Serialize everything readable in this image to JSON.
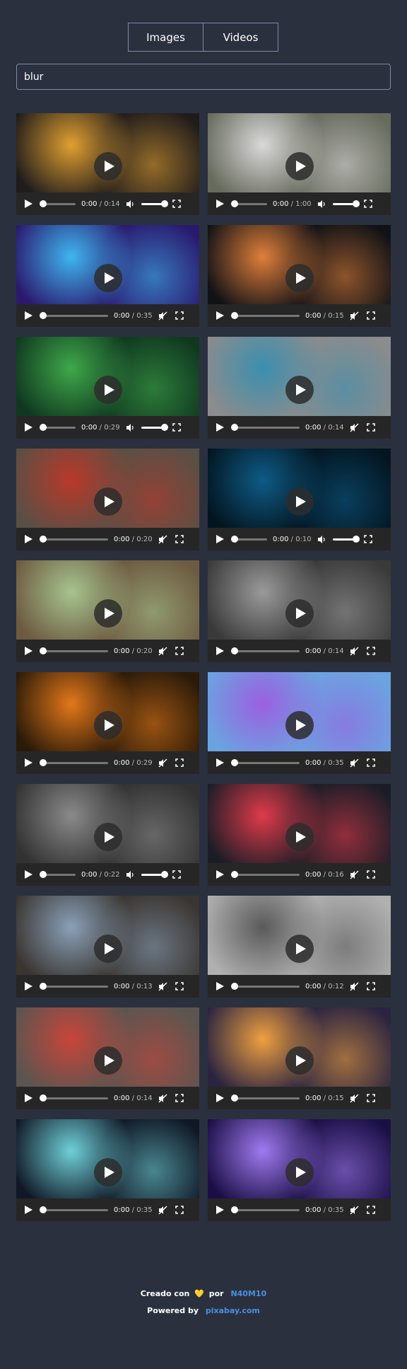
{
  "tabs": [
    {
      "label": "Images"
    },
    {
      "label": "Videos"
    }
  ],
  "search": {
    "value": "blur"
  },
  "videos": [
    {
      "current": "0:00",
      "duration": "0:14",
      "muted": false,
      "bg": "#201c1c",
      "accent": "#e0a030"
    },
    {
      "current": "0:00",
      "duration": "1:00",
      "muted": false,
      "bg": "#676a5d",
      "accent": "#d9d9d9"
    },
    {
      "current": "0:00",
      "duration": "0:35",
      "muted": true,
      "bg": "#2a1a6e",
      "accent": "#3fb6f0"
    },
    {
      "current": "0:00",
      "duration": "0:15",
      "muted": true,
      "bg": "#111216",
      "accent": "#e07f3a"
    },
    {
      "current": "0:00",
      "duration": "0:29",
      "muted": false,
      "bg": "#103820",
      "accent": "#3fa84a"
    },
    {
      "current": "0:00",
      "duration": "0:14",
      "muted": true,
      "bg": "#8c8c8c",
      "accent": "#3a8fb0"
    },
    {
      "current": "0:00",
      "duration": "0:20",
      "muted": true,
      "bg": "#5a4f45",
      "accent": "#b8392a"
    },
    {
      "current": "0:00",
      "duration": "0:10",
      "muted": false,
      "bg": "#031520",
      "accent": "#0e5b86"
    },
    {
      "current": "0:00",
      "duration": "0:20",
      "muted": true,
      "bg": "#6d5a40",
      "accent": "#a7c48f"
    },
    {
      "current": "0:00",
      "duration": "0:14",
      "muted": true,
      "bg": "#3a3a3a",
      "accent": "#9a9a9a"
    },
    {
      "current": "0:00",
      "duration": "0:29",
      "muted": true,
      "bg": "#2a1a08",
      "accent": "#e3781a"
    },
    {
      "current": "0:00",
      "duration": "0:35",
      "muted": true,
      "bg": "#6aa4e0",
      "accent": "#9b5fe0"
    },
    {
      "current": "0:00",
      "duration": "0:22",
      "muted": false,
      "bg": "#323232",
      "accent": "#8a8a8a"
    },
    {
      "current": "0:00",
      "duration": "0:16",
      "muted": true,
      "bg": "#1a1d26",
      "accent": "#e03a4a"
    },
    {
      "current": "0:00",
      "duration": "0:13",
      "muted": true,
      "bg": "#3a3530",
      "accent": "#8aa0b8"
    },
    {
      "current": "0:00",
      "duration": "0:12",
      "muted": true,
      "bg": "#b0b0b0",
      "accent": "#5a5a5a"
    },
    {
      "current": "0:00",
      "duration": "0:14",
      "muted": true,
      "bg": "#5a5550",
      "accent": "#c8453a"
    },
    {
      "current": "0:00",
      "duration": "0:15",
      "muted": true,
      "bg": "#2a2440",
      "accent": "#f0a040"
    },
    {
      "current": "0:00",
      "duration": "0:35",
      "muted": true,
      "bg": "#101825",
      "accent": "#6fd0d8"
    },
    {
      "current": "0:00",
      "duration": "0:35",
      "muted": true,
      "bg": "#1a0f45",
      "accent": "#a07af0"
    }
  ],
  "footer": {
    "created_text": "Creado con",
    "heart": "💛",
    "by_text": "por",
    "author": "N40M10",
    "powered_text": "Powered by",
    "powered_link": "pixabay.com"
  },
  "colors": {
    "background": "#2b303e",
    "border": "#7f8aa8",
    "link": "#4a90e2"
  }
}
